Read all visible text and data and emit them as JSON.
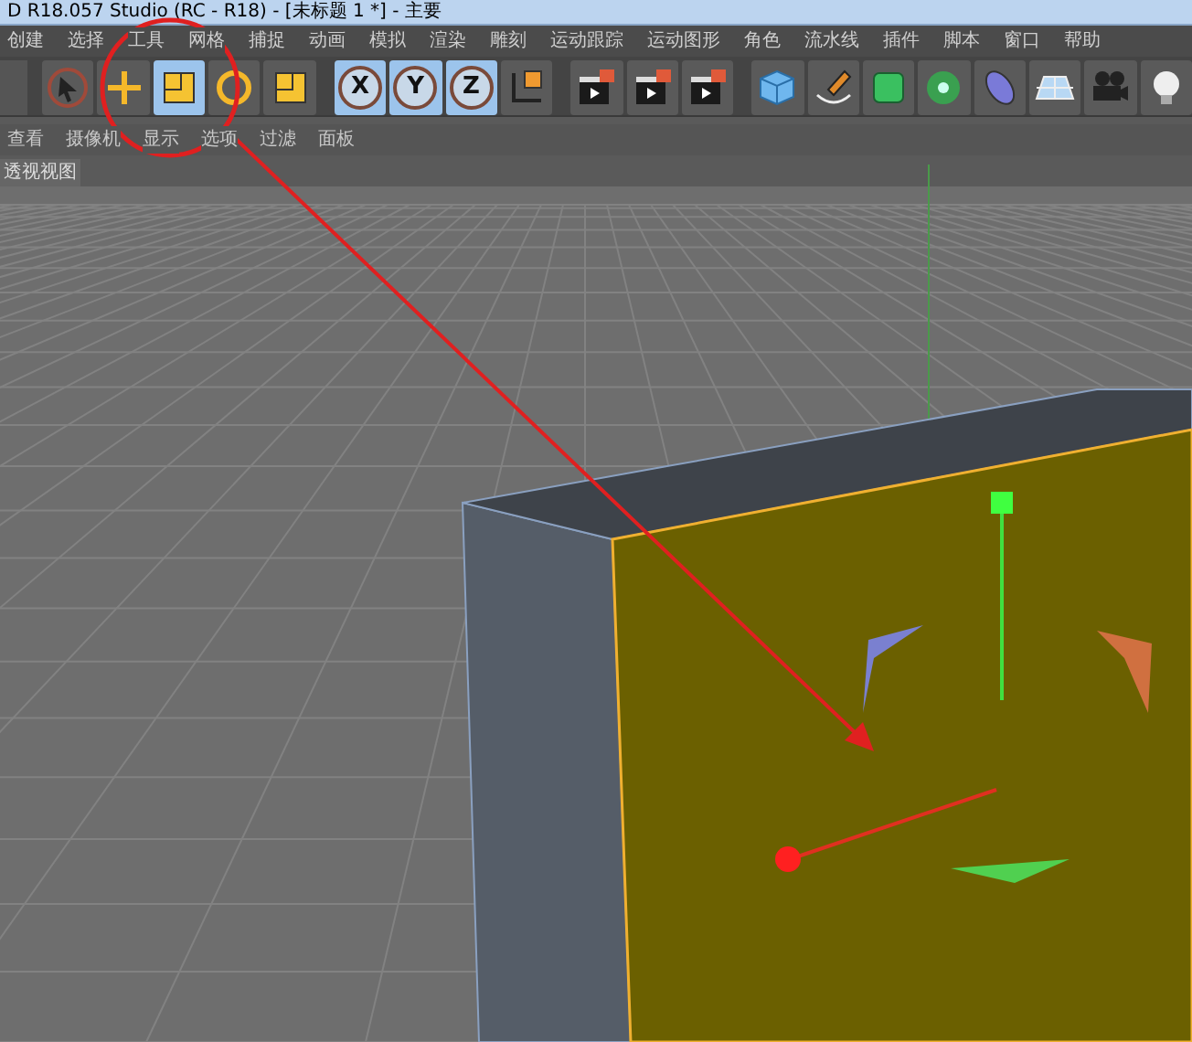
{
  "window": {
    "title": "D R18.057 Studio (RC - R18) - [未标题 1 *] - 主要"
  },
  "menu": [
    "创建",
    "选择",
    "工具",
    "网格",
    "捕捉",
    "动画",
    "模拟",
    "渲染",
    "雕刻",
    "运动跟踪",
    "运动图形",
    "角色",
    "流水线",
    "插件",
    "脚本",
    "窗口",
    "帮助"
  ],
  "toolbar": [
    {
      "kind": "select",
      "selected": false
    },
    {
      "kind": "move",
      "selected": false
    },
    {
      "kind": "scale",
      "selected": true
    },
    {
      "kind": "rotate",
      "selected": false
    },
    {
      "kind": "recent",
      "selected": false
    },
    {
      "kind": "axis",
      "label": "X",
      "selected": true
    },
    {
      "kind": "axis",
      "label": "Y",
      "selected": true
    },
    {
      "kind": "axis",
      "label": "Z",
      "selected": true
    },
    {
      "kind": "coords",
      "selected": false
    },
    {
      "kind": "render",
      "selected": false
    },
    {
      "kind": "render",
      "selected": false
    },
    {
      "kind": "render",
      "selected": false
    },
    {
      "kind": "cube",
      "selected": false
    },
    {
      "kind": "pen",
      "selected": false
    },
    {
      "kind": "subdiv",
      "selected": false
    },
    {
      "kind": "array",
      "selected": false
    },
    {
      "kind": "deformer",
      "selected": false
    },
    {
      "kind": "floor",
      "selected": false
    },
    {
      "kind": "camera",
      "selected": false
    },
    {
      "kind": "light",
      "selected": false
    }
  ],
  "viewport_menu": [
    "查看",
    "摄像机",
    "显示",
    "选项",
    "过滤",
    "面板"
  ],
  "viewport": {
    "title": "透视视图"
  }
}
